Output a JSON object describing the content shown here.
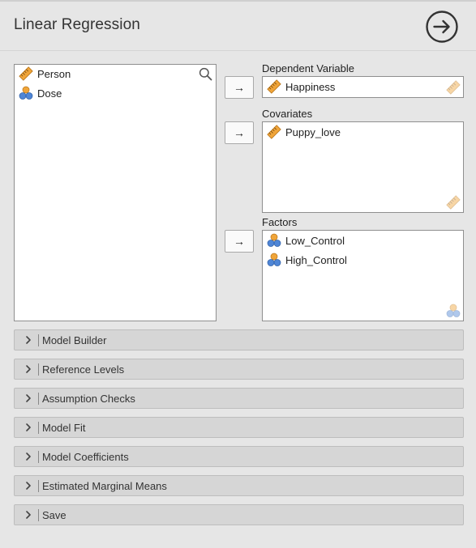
{
  "header": {
    "title": "Linear Regression",
    "run_icon": "arrow-circle-right-icon"
  },
  "variables": [
    {
      "label": "Person",
      "type": "scale",
      "icon": "ruler-icon"
    },
    {
      "label": "Dose",
      "type": "nominal",
      "icon": "nominal-icon"
    }
  ],
  "targets": {
    "dependent": {
      "label": "Dependent Variable",
      "items": [
        {
          "label": "Happiness",
          "type": "scale"
        }
      ]
    },
    "covariates": {
      "label": "Covariates",
      "items": [
        {
          "label": "Puppy_love",
          "type": "scale"
        }
      ]
    },
    "factors": {
      "label": "Factors",
      "items": [
        {
          "label": "Low_Control",
          "type": "nominal"
        },
        {
          "label": "High_Control",
          "type": "nominal"
        }
      ]
    }
  },
  "transfer_arrow": "→",
  "panels": [
    {
      "label": "Model Builder"
    },
    {
      "label": "Reference Levels"
    },
    {
      "label": "Assumption Checks"
    },
    {
      "label": "Model Fit"
    },
    {
      "label": "Model Coefficients"
    },
    {
      "label": "Estimated Marginal Means"
    },
    {
      "label": "Save"
    }
  ],
  "colors": {
    "background": "#e6e6e6",
    "scale_icon": "#f0a53a",
    "nominal_orange": "#f0a53a",
    "nominal_blue": "#4f86d6"
  }
}
